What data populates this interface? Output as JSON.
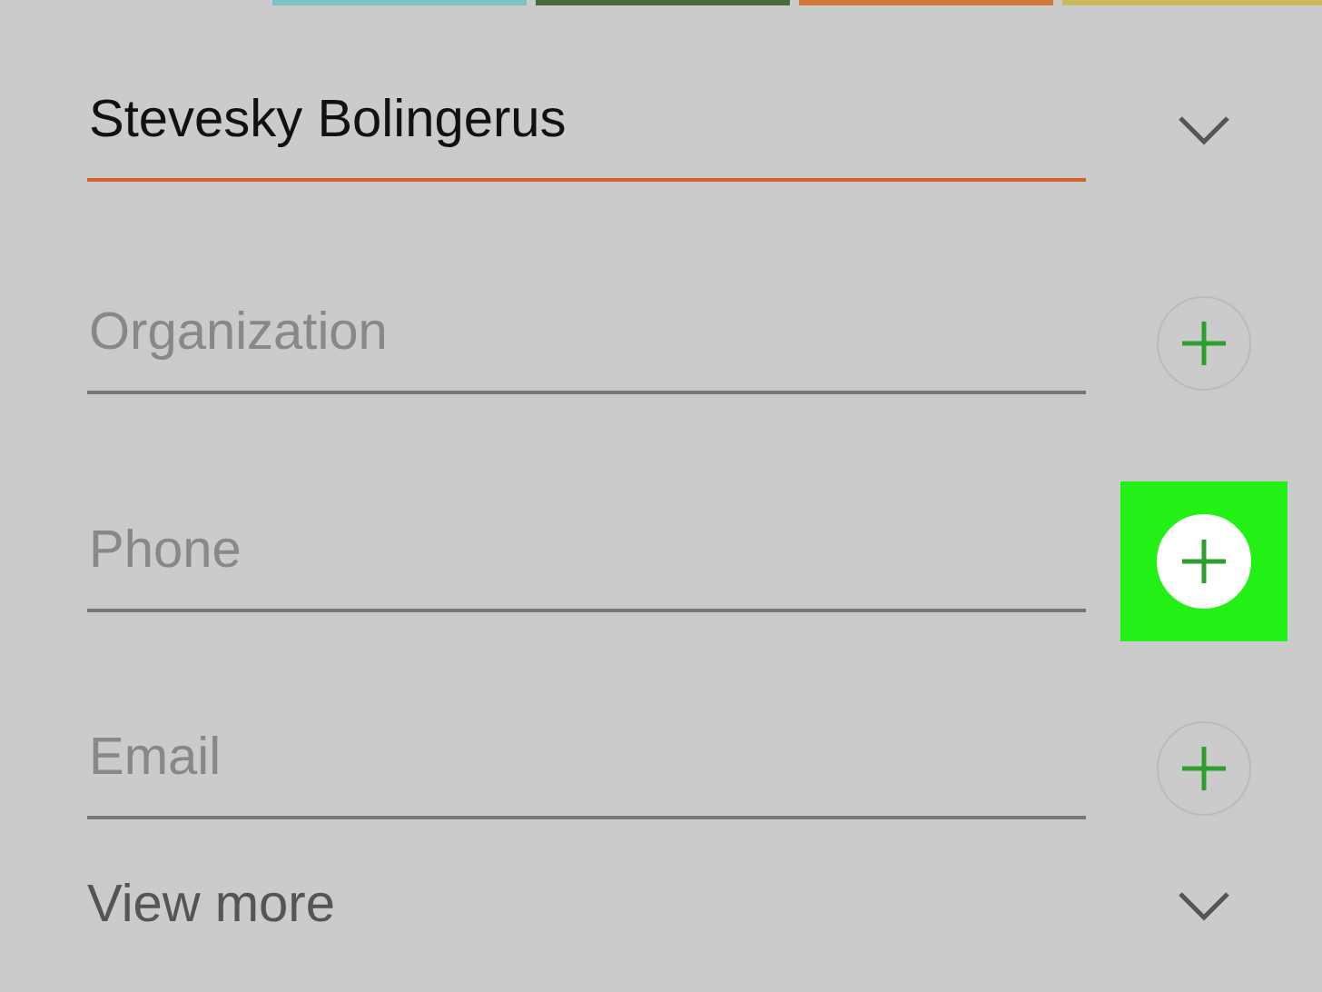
{
  "fields": [
    {
      "kind": "expandable",
      "value": "Stevesky Bolingerus",
      "focused": true
    },
    {
      "kind": "addable",
      "placeholder": "Organization",
      "focused": false,
      "highlighted": false
    },
    {
      "kind": "addable",
      "placeholder": "Phone",
      "focused": false,
      "highlighted": true
    },
    {
      "kind": "addable",
      "placeholder": "Email",
      "focused": false,
      "highlighted": false
    }
  ],
  "view_more": {
    "label": "View more",
    "expanded": false
  }
}
